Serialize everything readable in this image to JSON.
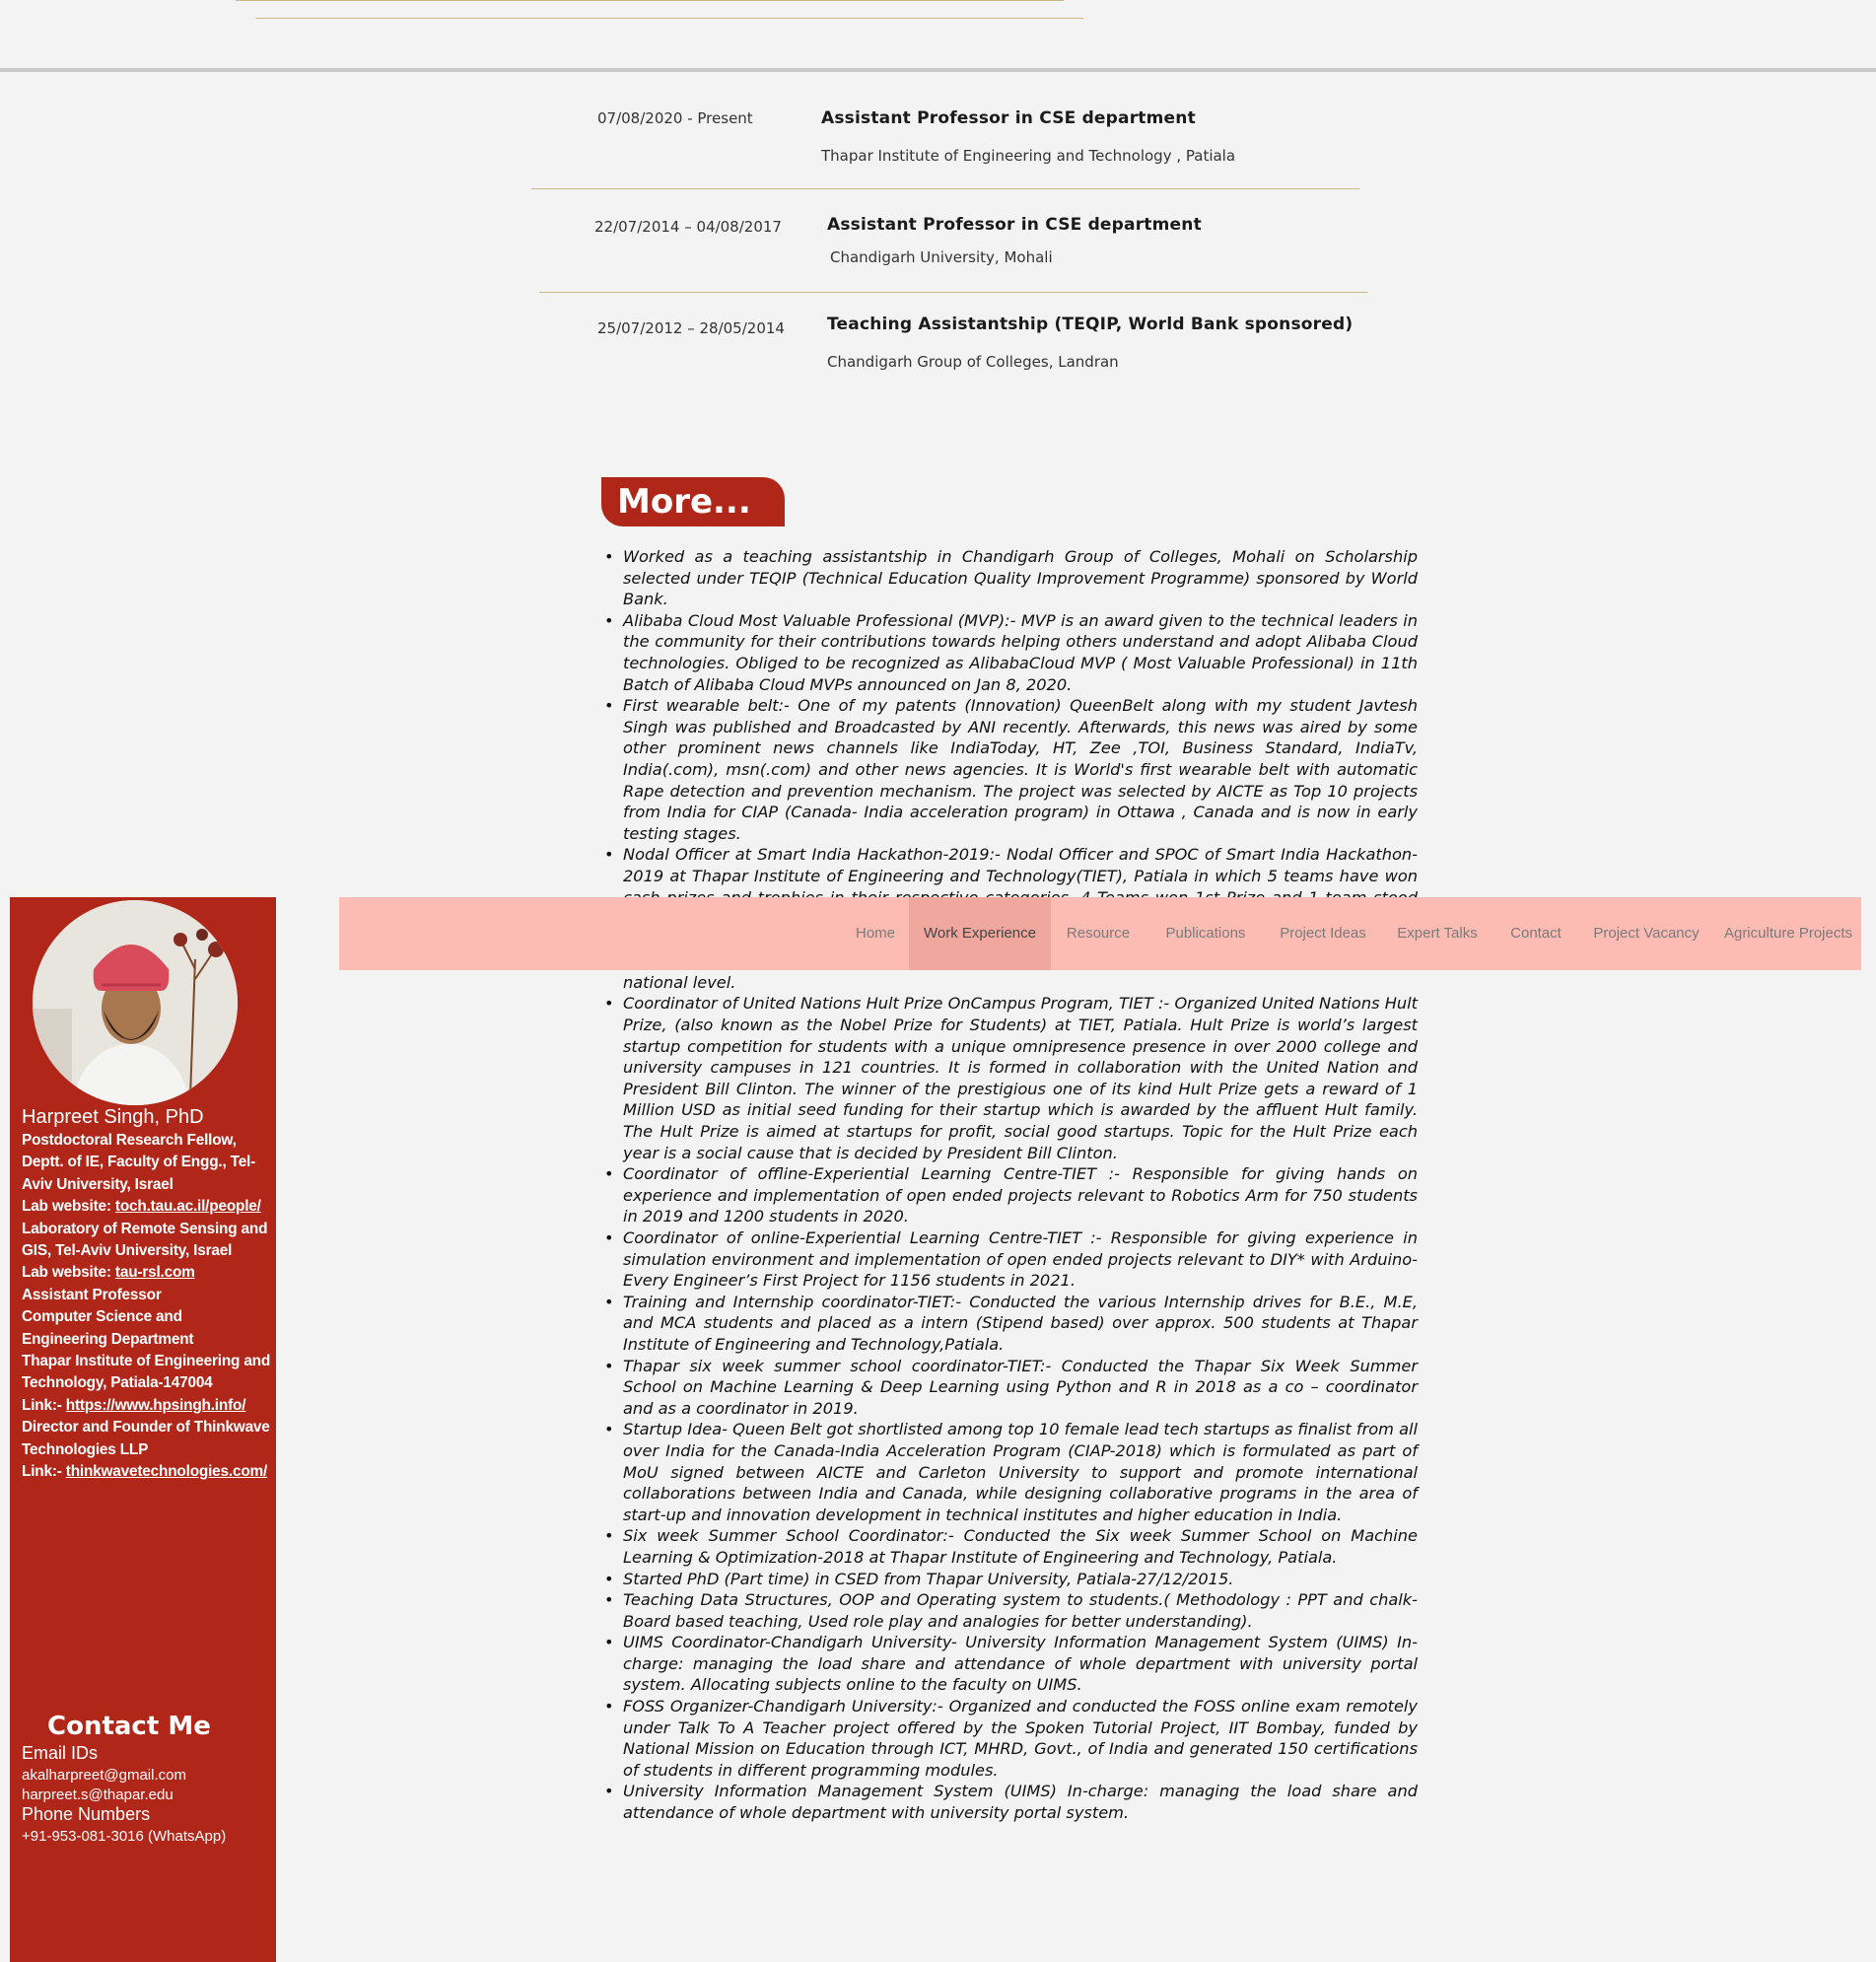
{
  "experience": [
    {
      "date": "07/08/2020 - Present",
      "title": "Assistant Professor in CSE department",
      "org": "Thapar Institute of Engineering and Technology , Patiala"
    },
    {
      "date": "22/07/2014 – 04/08/2017",
      "title": "Assistant Professor in CSE department",
      "org": "Chandigarh University, Mohali"
    },
    {
      "date": "25/07/2012 – 28/05/2014",
      "title": "Teaching Assistantship (TEQIP, World Bank sponsored)",
      "org": "Chandigarh Group of Colleges, Landran"
    }
  ],
  "more": {
    "title": "More...",
    "items": [
      "Worked as a teaching assistantship in Chandigarh Group of Colleges, Mohali on Scholarship selected under TEQIP (Technical Education Quality Improvement Programme) sponsored by World Bank.",
      "Alibaba Cloud Most Valuable Professional (MVP):- MVP is an award given to the technical leaders in the community for their contributions towards helping others understand and adopt Alibaba Cloud technologies. Obliged to be recognized as AlibabaCloud MVP ( Most Valuable Professional) in 11th Batch of Alibaba Cloud MVPs announced on Jan 8, 2020.",
      "First wearable belt:-  One of my patents (Innovation) QueenBelt along with my student Javtesh Singh was published and Broadcasted by ANI recently. Afterwards, this news was aired by some other prominent news channels like IndiaToday, HT, Zee ,TOI, Business Standard, IndiaTv, India(.com), msn(.com) and other news agencies. It is World's first wearable belt with automatic Rape detection and prevention mechanism. The project was selected by AICTE as Top 10 projects from India for CIAP (Canada- India acceleration program) in Ottawa , Canada and is now in early testing stages.",
      "Nodal Officer at Smart India Hackathon-2019:- Nodal Officer and SPOC of Smart India Hackathon-2019 at Thapar Institute of Engineering and Technology(TIET), Patiala in which 5 teams have won cash prizes and trophies in their respective categories. 4 Teams won 1st Prize and 1 team stood second in their respective categories. Conducted the Smart India Hackathon 2020 as a Nodal officer Internal Hackathon with participation of 50 teams from Software category and Hardware category. 5 teams from software and 2 teams from hardware category are recommended for the national level.",
      "Coordinator of United Nations Hult Prize OnCampus Program, TIET :- Organized United Nations Hult Prize, (also known as the Nobel Prize for Students) at TIET, Patiala. Hult Prize is world’s largest startup competition for students with a unique omnipresence presence in over 2000 college and university campuses in 121 countries. It is formed in collaboration with the United Nation and President Bill Clinton. The winner of the prestigious one of its kind Hult Prize gets a reward of 1 Million USD as initial seed funding for their startup which is awarded by the affluent Hult family. The Hult Prize is aimed at startups for profit, social good startups. Topic for the Hult Prize each year is a social cause that is decided by President Bill Clinton.",
      "Coordinator of offline-Experiential Learning Centre-TIET :- Responsible for giving hands on experience and implementation of open ended projects relevant to Robotics Arm for 750 students in 2019 and 1200 students in 2020.",
      "Coordinator of online-Experiential Learning Centre-TIET :- Responsible for giving experience in simulation environment  and implementation of open ended projects relevant to DIY* with Arduino-Every Engineer’s First Project for 1156 students in 2021.",
      "Training and Internship coordinator-TIET:- Conducted the various Internship drives for B.E., M.E, and MCA students and placed as a intern (Stipend based) over approx. 500 students at Thapar Institute of Engineering and Technology,Patiala.",
      "Thapar six week summer school coordinator-TIET:- Conducted the Thapar Six Week Summer School on Machine Learning & Deep Learning using Python and R in 2018 as a co – coordinator and as a coordinator in 2019.",
      "Startup Idea- Queen Belt got shortlisted among top 10 female lead tech startups as finalist from all over India for the Canada-India Acceleration Program (CIAP-2018) which is formulated as part of MoU signed between AICTE and Carleton University to support and promote international collaborations between India and Canada, while designing collaborative programs in the area of start-up and innovation development in technical institutes and higher education in India.",
      "Six week Summer School Coordinator:- Conducted the Six week Summer School on Machine Learning & Optimization-2018 at Thapar Institute of Engineering and Technology, Patiala.",
      "Started PhD (Part time) in CSED from Thapar University, Patiala-27/12/2015.",
      "Teaching Data Structures, OOP and Operating system to students.( Methodology : PPT and  chalk- Board based teaching, Used role play and analogies for better understanding).",
      "UIMS Coordinator-Chandigarh University- University Information Management System (UIMS) In-charge: managing the load share and attendance of whole department with university portal system. Allocating subjects online to the faculty on UIMS.",
      "FOSS Organizer-Chandigarh University:- Organized and conducted the FOSS online exam remotely under Talk To A Teacher project offered by the Spoken Tutorial Project, IIT Bombay, funded by National Mission on Education through ICT, MHRD, Govt., of India and generated 150 certifications of students in different programming modules.",
      "University Information Management System (UIMS) In-charge: managing the load share and attendance of whole department with university portal system."
    ]
  },
  "nav": {
    "items": [
      "Home",
      "Work Experience",
      "Resource",
      "Publications",
      "Project Ideas",
      "Expert Talks",
      "Contact",
      "Project Vacancy",
      "Agriculture Projects"
    ],
    "active": "Work Experience"
  },
  "sidebar": {
    "name": "Harpreet Singh, PhD",
    "lines": [
      {
        "text": "Postdoctoral Research Fellow,"
      },
      {
        "text": "Deptt. of IE, Faculty of Engg., Tel-"
      },
      {
        "text": "Aviv University, Israel"
      },
      {
        "prefix": "Lab website: ",
        "link": "toch.tau.ac.il/people/"
      },
      {
        "text": "Laboratory of Remote Sensing and"
      },
      {
        "text": "GIS, Tel-Aviv University, Israel"
      },
      {
        "prefix": "Lab website: ",
        "link": "tau-rsl.com"
      },
      {
        "text": "Assistant Professor"
      },
      {
        "text": "Computer Science and"
      },
      {
        "text": "Engineering Department"
      },
      {
        "text": "Thapar Institute of Engineering and"
      },
      {
        "text": "Technology, Patiala-147004"
      },
      {
        "prefix": "Link:- ",
        "link": "https://www.hpsingh.info/"
      },
      {
        "text": "Director and Founder of Thinkwave"
      },
      {
        "text": "Technologies LLP"
      },
      {
        "prefix": "Link:- ",
        "link": "thinkwavetechnologies.com/"
      }
    ],
    "contact_title": "Contact Me",
    "email_heading": "Email IDs",
    "emails": [
      "akalharpreet@gmail.com",
      "harpreet.s@thapar.edu"
    ],
    "phone_heading": "Phone Numbers",
    "phone": "+91-953-081-3016 (WhatsApp)"
  },
  "colors": {
    "sidebar_bg": "#b0271a",
    "nav_bg": "#fdbcb3",
    "nav_active_bg": "#f0a79e",
    "divider_gold": "#c8b98a",
    "page_bg": "#f3f3f3"
  }
}
